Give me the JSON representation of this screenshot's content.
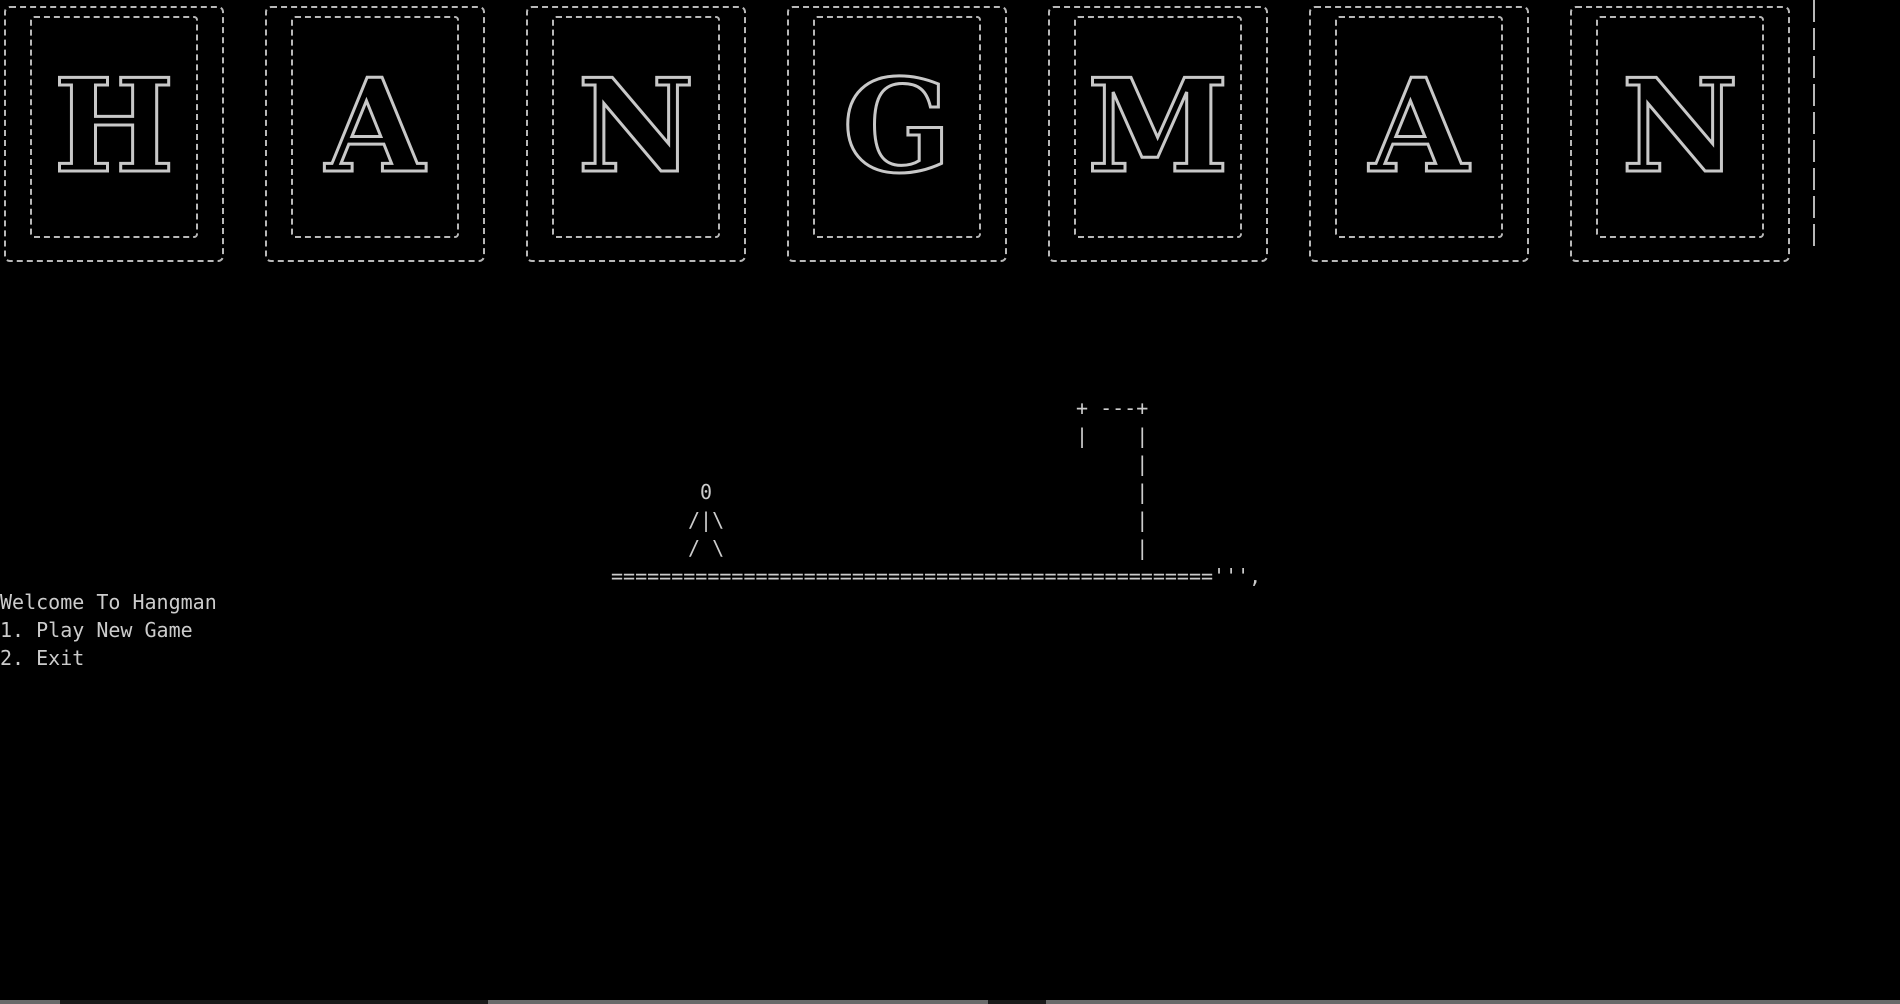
{
  "banner": {
    "letters": [
      "H",
      "A",
      "N",
      "G",
      "M",
      "A",
      "N"
    ]
  },
  "scene": {
    "gallows": "+ ---+\n|    |\n     |\n     |\n     |\n     |",
    "stickman": " 0\n/|\\\n/ \\",
    "ground": "==================================================''',"
  },
  "menu": {
    "welcome": "Welcome To Hangman",
    "option_play": "1. Play New Game",
    "option_exit": "2. Exit"
  },
  "colors": {
    "background": "#000000",
    "text": "#cccccc"
  }
}
